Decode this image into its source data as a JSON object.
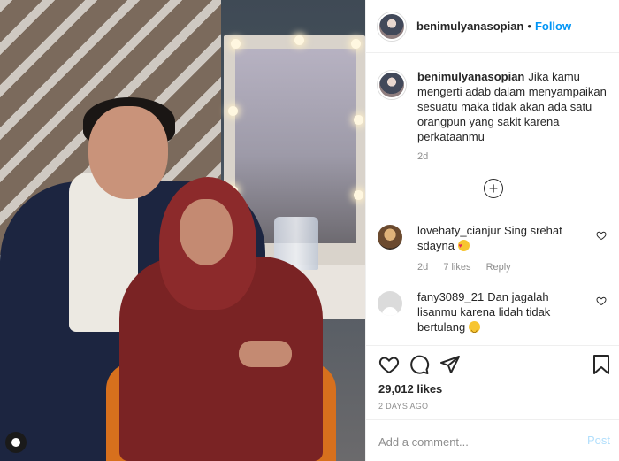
{
  "post": {
    "username": "benimulyanasopian",
    "separator": "•",
    "follow_label": "Follow"
  },
  "caption": {
    "username": "benimulyanasopian",
    "text": "Jika kamu mengerti adab dalam menyampaikan sesuatu maka tidak akan ada satu orangpun yang sakit karena perkataanmu",
    "time": "2d"
  },
  "comments": [
    {
      "username": "lovehaty_cianjur",
      "text": "Sing srehat sdayna",
      "emoji": "heart-eyes-emoji",
      "time": "2d",
      "likes": "7 likes",
      "reply_label": "Reply"
    },
    {
      "username": "fany3089_21",
      "text": "Dan jagalah lisanmu karena lidah tidak bertulang",
      "emoji": "smile-emoji"
    }
  ],
  "stats": {
    "likes": "29,012 likes",
    "posted": "2 DAYS AGO"
  },
  "composer": {
    "placeholder": "Add a comment...",
    "post_label": "Post"
  },
  "colors": {
    "accent": "#0095f6",
    "post_disabled": "#b2dffc",
    "muted": "#8e8e8e"
  }
}
